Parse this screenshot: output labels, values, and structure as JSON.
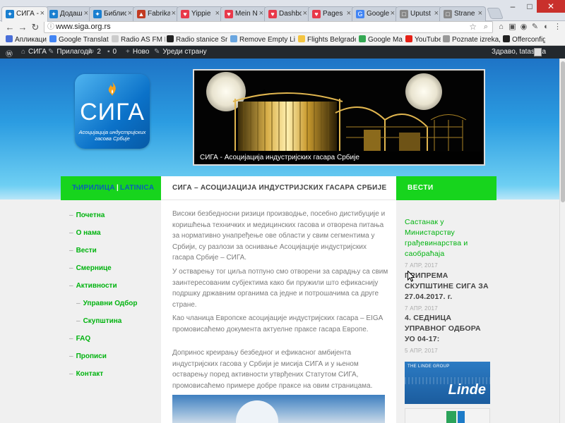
{
  "browser": {
    "tabs": [
      {
        "label": "СИГА -",
        "color": "#1a7fd0",
        "glyph": "✦",
        "active": true
      },
      {
        "label": "Додаш",
        "color": "#1a7fd0",
        "glyph": "✦"
      },
      {
        "label": "Библис",
        "color": "#1a7fd0",
        "glyph": "✦"
      },
      {
        "label": "Fabrika",
        "color": "#c23b22",
        "glyph": "▲"
      },
      {
        "label": "Yippie",
        "color": "#e8394a",
        "glyph": "♥"
      },
      {
        "label": "Mein Ne",
        "color": "#e8394a",
        "glyph": "♥"
      },
      {
        "label": "Dashbo",
        "color": "#e8394a",
        "glyph": "♥"
      },
      {
        "label": "Pages",
        "color": "#e8394a",
        "glyph": "♥"
      },
      {
        "label": "Google",
        "color": "#4285f4",
        "glyph": "G"
      },
      {
        "label": "Uputst",
        "color": "#888888",
        "glyph": "□"
      },
      {
        "label": "Strane",
        "color": "#888888",
        "glyph": "□"
      }
    ],
    "url": "www.siga.org.rs",
    "bookmarks": [
      {
        "label": "Апликације",
        "color": "#4a6fd8"
      },
      {
        "label": "Google Translate",
        "color": "#4285f4"
      },
      {
        "label": "Radio AS FM Live stre",
        "color": "#cccccc"
      },
      {
        "label": "Radio stanice Srbije -",
        "color": "#222222"
      },
      {
        "label": "Remove Empty Lines",
        "color": "#6aa6e0"
      },
      {
        "label": "Flights Belgrade - Bar",
        "color": "#f4c542"
      },
      {
        "label": "Google Maps",
        "color": "#34a853"
      },
      {
        "label": "YouTube",
        "color": "#e62117"
      },
      {
        "label": "Poznate izreka, zagon",
        "color": "#999999"
      },
      {
        "label": "Offerconfig",
        "color": "#222222"
      }
    ]
  },
  "wpbar": {
    "site": "СИГА",
    "customize": "Прилагоди",
    "updates": "2",
    "comments": "0",
    "new": "Ново",
    "edit": "Уреди страну",
    "greeting": "Здраво, tatasajta"
  },
  "header": {
    "logo_name": "СИГА",
    "logo_tagline": "Асоцијација индустријских гасова Србије",
    "banner_caption": "СИГА - Асоцијација индустријских гасара Србије"
  },
  "lang": {
    "cyr": "ЋИРИЛИЦА",
    "lat": "LATINICA"
  },
  "page": {
    "title": "СИГА – АСОЦИЈАЦИЈА ИНДУСТРИЈСКИХ ГАСАРА СРБИЈЕ",
    "paragraphs": [
      "Високи безбедносни ризици производње, посебно дистибуције и коришћења техничких и медицинских гасова и отворена питања за нормативно унапређење ове области у свим сегментима у Србији, су разлози за оснивање Асоцијације индустријских гасара Србије – СИГА.",
      "У остварењу тог циља потпуно смо отворени за сарадњу са свим заинтересованим субјектима како би пружили што ефикаснију подршку државним органима са једне и потрошачима са друге стране.",
      "Као чланица Европске асоцијације индустријских гасара – EIGA промовисаћемо документа актуелне праксе гасара Европе.",
      "Допринос креирању безбедног и ефикасног амбијента индустријских гасова у Србији је мисија СИГА и у њеном остварењу поред активности утврђених Статутом СИГА, промовисаћемо примере добре праксе на овим страницама."
    ]
  },
  "nav": [
    {
      "label": "Почетна",
      "level": 0
    },
    {
      "label": "О нама",
      "level": 0
    },
    {
      "label": "Вести",
      "level": 0
    },
    {
      "label": "Смернице",
      "level": 0
    },
    {
      "label": "Активности",
      "level": 0
    },
    {
      "label": "Управни Одбор",
      "level": 1
    },
    {
      "label": "Скупштина",
      "level": 1
    },
    {
      "label": "FAQ",
      "level": 0
    },
    {
      "label": "Прописи",
      "level": 0
    },
    {
      "label": "Контакт",
      "level": 0
    }
  ],
  "news": {
    "heading": "ВЕСТИ",
    "items": [
      {
        "title": "Састанак у Министарству грађевинарства и саобраћаја",
        "date": "7 АПР, 2017",
        "highlight": true
      },
      {
        "title": "ПРИПРЕМА СКУПШТИНЕ СИГА ЗА 27.04.2017. г.",
        "date": "7 АПР, 2017",
        "highlight": false
      },
      {
        "title": "4. СЕДНИЦА УПРАВНОГ ОДБОРА УО 04-17:",
        "date": "5 АПР, 2017",
        "highlight": false
      }
    ],
    "ad_group": "THE LINDE GROUP",
    "ad_name": "Linde"
  },
  "colors": {
    "accent_green": "#17d41d",
    "link_green": "#00b30f",
    "header_blue": "#1e74c6"
  }
}
